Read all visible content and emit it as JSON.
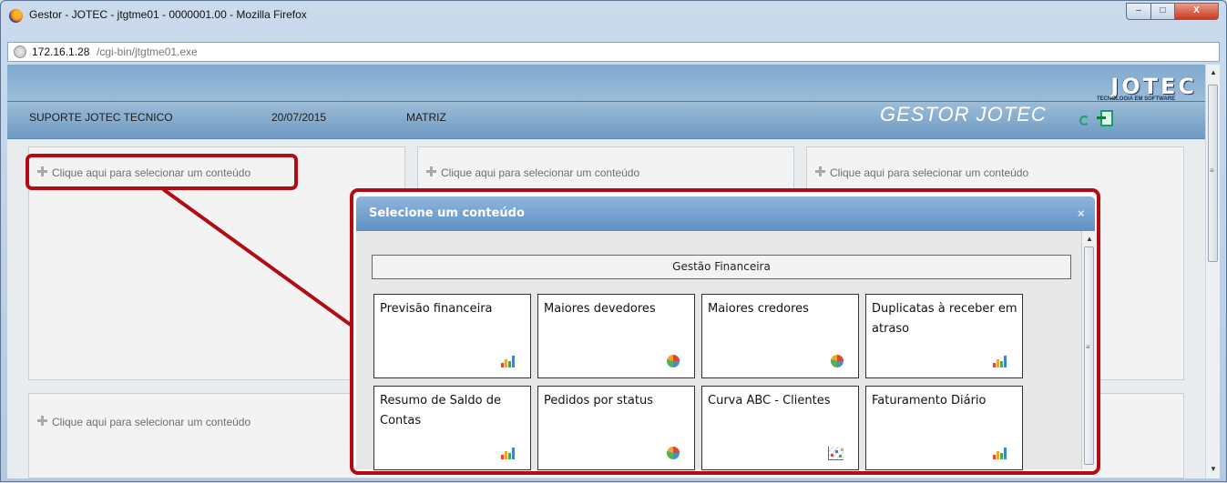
{
  "window": {
    "title": "Gestor - JOTEC - jtgtme01 - 0000001.00 - Mozilla Firefox",
    "min": "–",
    "max": "□",
    "close": "X"
  },
  "address": {
    "host": "172.16.1.28",
    "path": "/cgi-bin/jtgtme01.exe"
  },
  "header": {
    "user": "SUPORTE JOTEC TECNICO",
    "date": "20/07/2015",
    "branch": "MATRIZ",
    "app_name": "GESTOR JOTEC",
    "logo": "JOTEC",
    "logo_tagline": "TECNOLOGIA EM SOFTWARE"
  },
  "panels": {
    "select_label": "Clique aqui para selecionar um conteúdo"
  },
  "modal": {
    "title": "Selecione um conteúdo",
    "close": "×",
    "group": "Gestão Financeira",
    "cards": [
      {
        "title": "Previsão financeira",
        "icon": "bar-chart-icon"
      },
      {
        "title": "Maiores devedores",
        "icon": "pie-chart-icon"
      },
      {
        "title": "Maiores credores",
        "icon": "pie-chart-icon"
      },
      {
        "title": "Duplicatas à receber em atraso",
        "icon": "bar-chart-icon"
      },
      {
        "title": "Resumo de Saldo de Contas",
        "icon": "bar-chart-icon"
      },
      {
        "title": "Pedidos por status",
        "icon": "pie-chart-icon"
      },
      {
        "title": "Curva ABC - Clientes",
        "icon": "scatter-chart-icon"
      },
      {
        "title": "Faturamento Diário",
        "icon": "bar-chart-icon"
      }
    ]
  },
  "colors": {
    "highlight": "#b20b14",
    "header": "#7fa9cf",
    "modal_header": "#5f90c3"
  }
}
